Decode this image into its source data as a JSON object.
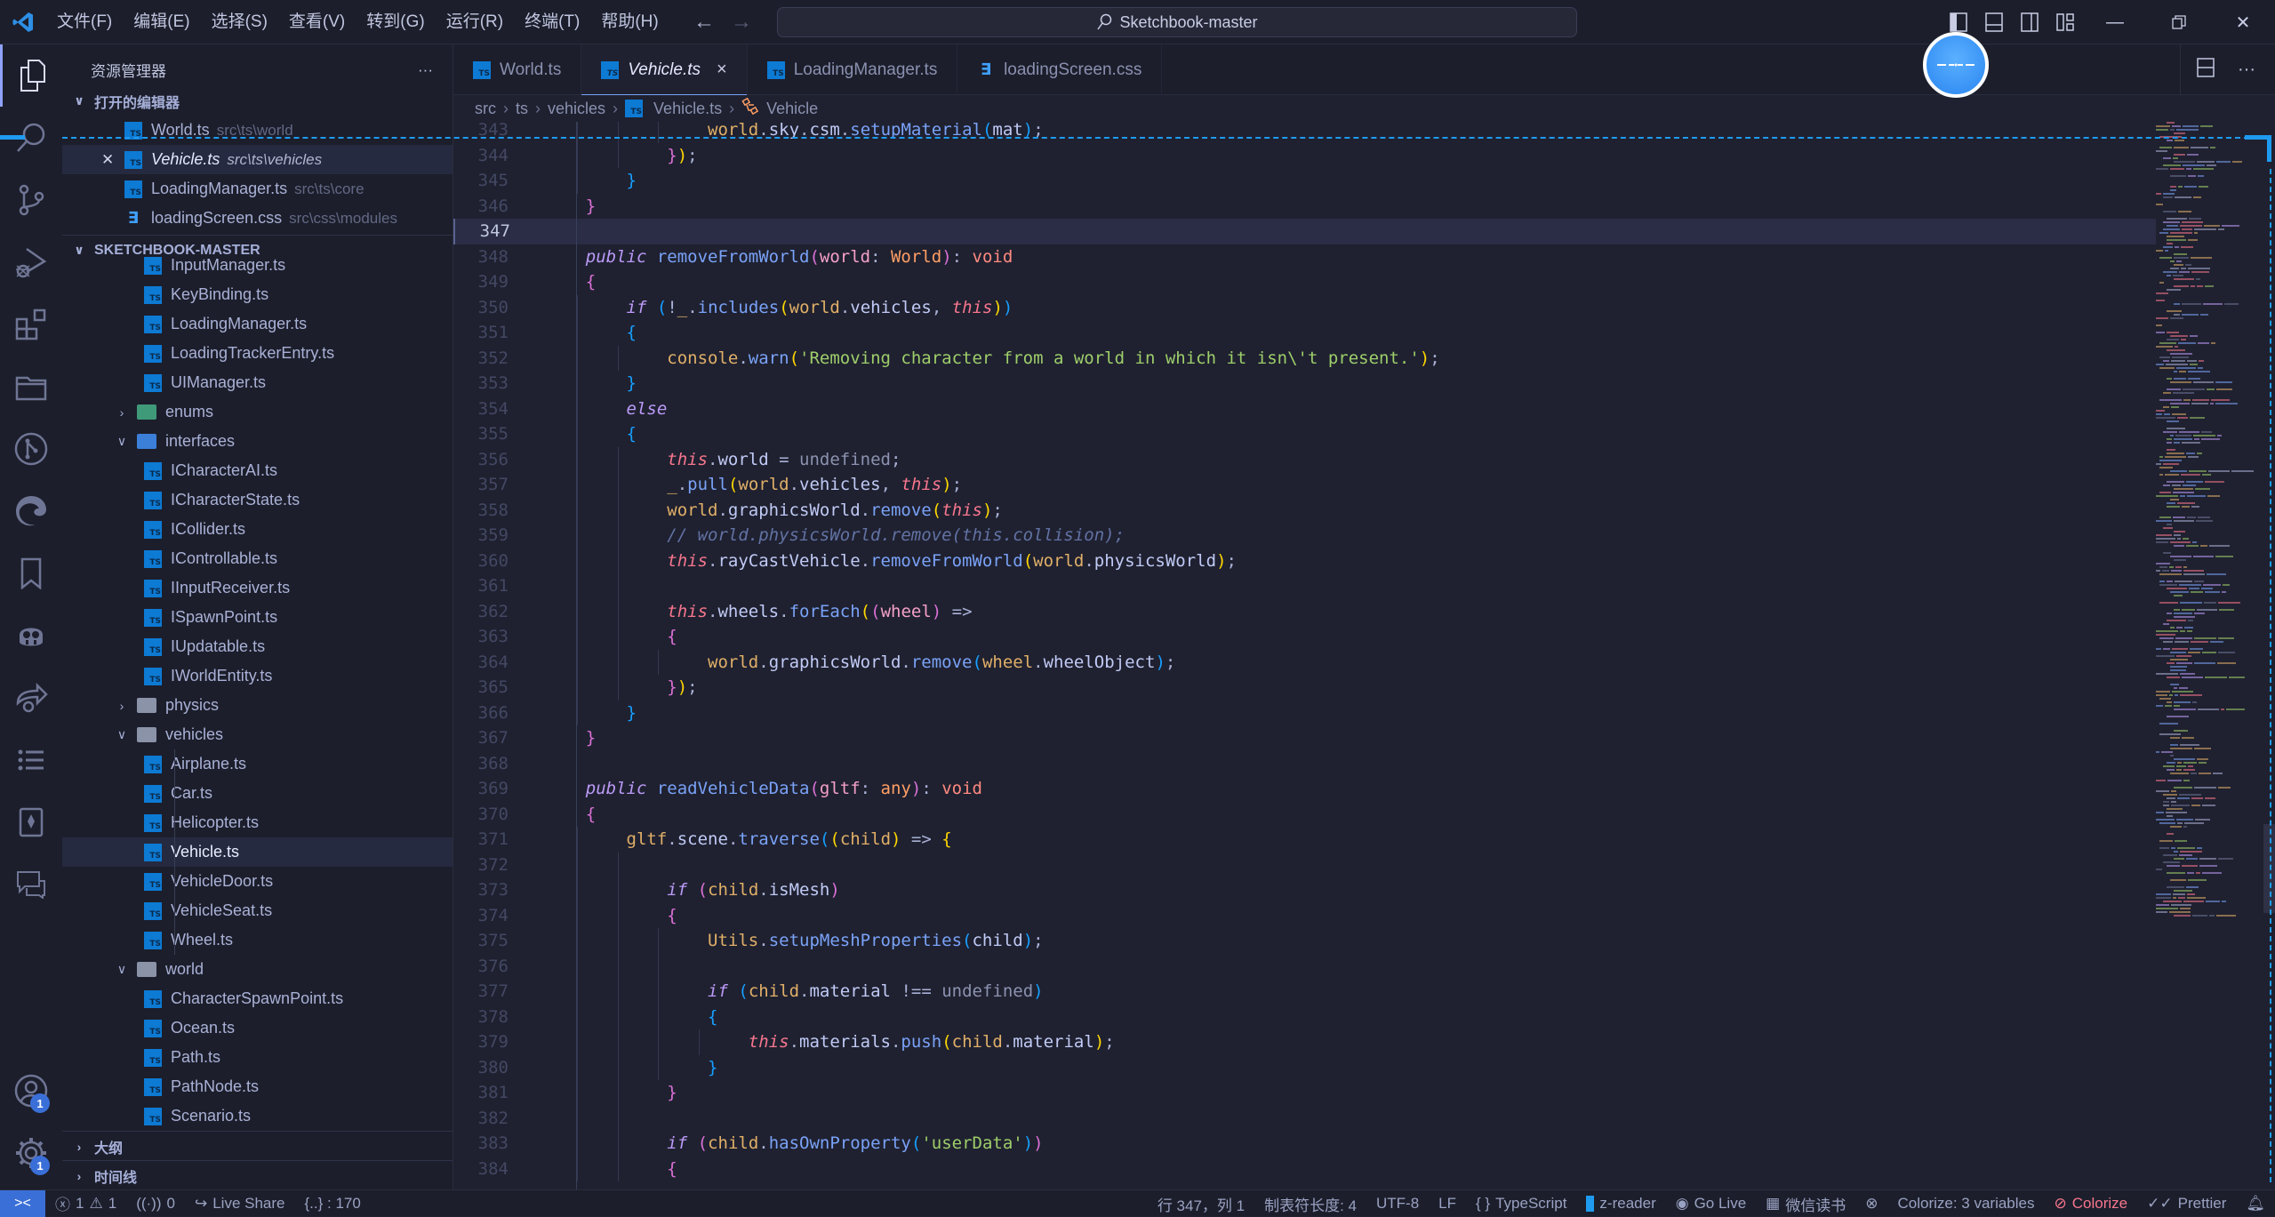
{
  "titlebar": {
    "menu": [
      "文件(F)",
      "编辑(E)",
      "选择(S)",
      "查看(V)",
      "转到(G)",
      "运行(R)",
      "终端(T)",
      "帮助(H)"
    ],
    "search_text": "Sketchbook-master"
  },
  "sidebar": {
    "title": "资源管理器",
    "more": "···",
    "open_editors": {
      "label": "打开的编辑器",
      "items": [
        {
          "name": "World.ts",
          "path": "src\\ts\\world",
          "icon": "ts"
        },
        {
          "name": "Vehicle.ts",
          "path": "src\\ts\\vehicles",
          "icon": "ts",
          "active": true
        },
        {
          "name": "LoadingManager.ts",
          "path": "src\\ts\\core",
          "icon": "ts"
        },
        {
          "name": "loadingScreen.css",
          "path": "src\\css\\modules",
          "icon": "css"
        }
      ]
    },
    "project": {
      "label": "SKETCHBOOK-MASTER",
      "tree": [
        {
          "name": "InputManager.ts",
          "type": "file",
          "depth": 2
        },
        {
          "name": "KeyBinding.ts",
          "type": "file",
          "depth": 2
        },
        {
          "name": "LoadingManager.ts",
          "type": "file",
          "depth": 2
        },
        {
          "name": "LoadingTrackerEntry.ts",
          "type": "file",
          "depth": 2
        },
        {
          "name": "UIManager.ts",
          "type": "file",
          "depth": 2
        },
        {
          "name": "enums",
          "type": "folder",
          "expanded": false,
          "depth": 1,
          "color": "green"
        },
        {
          "name": "interfaces",
          "type": "folder",
          "expanded": true,
          "depth": 1,
          "color": "blue"
        },
        {
          "name": "ICharacterAI.ts",
          "type": "file",
          "depth": 2
        },
        {
          "name": "ICharacterState.ts",
          "type": "file",
          "depth": 2
        },
        {
          "name": "ICollider.ts",
          "type": "file",
          "depth": 2
        },
        {
          "name": "IControllable.ts",
          "type": "file",
          "depth": 2
        },
        {
          "name": "IInputReceiver.ts",
          "type": "file",
          "depth": 2
        },
        {
          "name": "ISpawnPoint.ts",
          "type": "file",
          "depth": 2
        },
        {
          "name": "IUpdatable.ts",
          "type": "file",
          "depth": 2
        },
        {
          "name": "IWorldEntity.ts",
          "type": "file",
          "depth": 2
        },
        {
          "name": "physics",
          "type": "folder",
          "expanded": false,
          "depth": 1,
          "color": "grey"
        },
        {
          "name": "vehicles",
          "type": "folder",
          "expanded": true,
          "depth": 1,
          "color": "grey"
        },
        {
          "name": "Airplane.ts",
          "type": "file",
          "depth": 2
        },
        {
          "name": "Car.ts",
          "type": "file",
          "depth": 2
        },
        {
          "name": "Helicopter.ts",
          "type": "file",
          "depth": 2
        },
        {
          "name": "Vehicle.ts",
          "type": "file",
          "depth": 2,
          "selected": true
        },
        {
          "name": "VehicleDoor.ts",
          "type": "file",
          "depth": 2
        },
        {
          "name": "VehicleSeat.ts",
          "type": "file",
          "depth": 2
        },
        {
          "name": "Wheel.ts",
          "type": "file",
          "depth": 2
        },
        {
          "name": "world",
          "type": "folder",
          "expanded": true,
          "depth": 1,
          "color": "grey"
        },
        {
          "name": "CharacterSpawnPoint.ts",
          "type": "file",
          "depth": 2
        },
        {
          "name": "Ocean.ts",
          "type": "file",
          "depth": 2
        },
        {
          "name": "Path.ts",
          "type": "file",
          "depth": 2
        },
        {
          "name": "PathNode.ts",
          "type": "file",
          "depth": 2
        },
        {
          "name": "Scenario.ts",
          "type": "file",
          "depth": 2
        }
      ]
    },
    "outline_label": "大纲",
    "timeline_label": "时间线"
  },
  "activity_badges": {
    "accounts": "1",
    "settings": "1"
  },
  "tabs": [
    {
      "label": "World.ts",
      "icon": "ts"
    },
    {
      "label": "Vehicle.ts",
      "icon": "ts",
      "active": true
    },
    {
      "label": "LoadingManager.ts",
      "icon": "ts"
    },
    {
      "label": "loadingScreen.css",
      "icon": "css"
    }
  ],
  "tab_close": "×",
  "breadcrumb": [
    "src",
    "ts",
    "vehicles",
    "Vehicle.ts",
    "Vehicle"
  ],
  "editor": {
    "current_line": 347,
    "lines": [
      {
        "n": 343,
        "indent": 3,
        "html": "<span class=\"v\">world</span><span class=\"p\">.</span><span class=\"ob\">sky</span><span class=\"p\">.</span><span class=\"ob\">csm</span><span class=\"p\">.</span><span class=\"f\">setupMaterial</span><span class=\"b3\">(</span><span class=\"ob\">mat</span><span class=\"b3\">)</span><span class=\"p\">;</span>"
      },
      {
        "n": 344,
        "indent": 2,
        "html": "<span class=\"b2\">}</span><span class=\"b1\">)</span><span class=\"p\">;</span>"
      },
      {
        "n": 345,
        "indent": 1,
        "html": "<span class=\"b3\">}</span>"
      },
      {
        "n": 346,
        "indent": 0,
        "html": "<span class=\"b2\">}</span>"
      },
      {
        "n": 347,
        "indent": 0,
        "html": ""
      },
      {
        "n": 348,
        "indent": 0,
        "html": "<span class=\"k\">public</span> <span class=\"f\">removeFromWorld</span><span class=\"b2\">(</span><span class=\"param\">world</span><span class=\"p\">: </span><span class=\"ty\">World</span><span class=\"b2\">)</span><span class=\"p\">: </span><span class=\"vo\">void</span>"
      },
      {
        "n": 349,
        "indent": 0,
        "html": "<span class=\"b2\">{</span>"
      },
      {
        "n": 350,
        "indent": 1,
        "html": "<span class=\"k\">if</span> <span class=\"b3\">(</span><span class=\"p\">!</span><span class=\"v\">_</span><span class=\"p\">.</span><span class=\"f\">includes</span><span class=\"b1\">(</span><span class=\"v\">world</span><span class=\"p\">.</span><span class=\"ob\">vehicles</span><span class=\"p\">, </span><span class=\"t\">this</span><span class=\"b1\">)</span><span class=\"b3\">)</span>"
      },
      {
        "n": 351,
        "indent": 1,
        "html": "<span class=\"b3\">{</span>"
      },
      {
        "n": 352,
        "indent": 2,
        "html": "<span class=\"v\">console</span><span class=\"p\">.</span><span class=\"f\">warn</span><span class=\"b1\">(</span><span class=\"s\">'Removing character from a world in which it isn\\'t present.'</span><span class=\"b1\">)</span><span class=\"p\">;</span>"
      },
      {
        "n": 353,
        "indent": 1,
        "html": "<span class=\"b3\">}</span>"
      },
      {
        "n": 354,
        "indent": 1,
        "html": "<span class=\"k\">else</span>"
      },
      {
        "n": 355,
        "indent": 1,
        "html": "<span class=\"b3\">{</span>"
      },
      {
        "n": 356,
        "indent": 2,
        "html": "<span class=\"t\">this</span><span class=\"p\">.</span><span class=\"ob\">world</span><span class=\"p\"> = </span><span class=\"u\">undefined</span><span class=\"p\">;</span>"
      },
      {
        "n": 357,
        "indent": 2,
        "html": "<span class=\"v\">_</span><span class=\"p\">.</span><span class=\"f\">pull</span><span class=\"b1\">(</span><span class=\"v\">world</span><span class=\"p\">.</span><span class=\"ob\">vehicles</span><span class=\"p\">, </span><span class=\"t\">this</span><span class=\"b1\">)</span><span class=\"p\">;</span>"
      },
      {
        "n": 358,
        "indent": 2,
        "html": "<span class=\"v\">world</span><span class=\"p\">.</span><span class=\"ob\">graphicsWorld</span><span class=\"p\">.</span><span class=\"f\">remove</span><span class=\"b1\">(</span><span class=\"t\">this</span><span class=\"b1\">)</span><span class=\"p\">;</span>"
      },
      {
        "n": 359,
        "indent": 2,
        "html": "<span class=\"c\">// world.physicsWorld.remove(this.collision);</span>"
      },
      {
        "n": 360,
        "indent": 2,
        "html": "<span class=\"t\">this</span><span class=\"p\">.</span><span class=\"ob\">rayCastVehicle</span><span class=\"p\">.</span><span class=\"f\">removeFromWorld</span><span class=\"b1\">(</span><span class=\"v\">world</span><span class=\"p\">.</span><span class=\"ob\">physicsWorld</span><span class=\"b1\">)</span><span class=\"p\">;</span>"
      },
      {
        "n": 361,
        "indent": 2,
        "html": ""
      },
      {
        "n": 362,
        "indent": 2,
        "html": "<span class=\"t\">this</span><span class=\"p\">.</span><span class=\"ob\">wheels</span><span class=\"p\">.</span><span class=\"f\">forEach</span><span class=\"b1\">(</span><span class=\"b2\">(</span><span class=\"param\">wheel</span><span class=\"b2\">)</span><span class=\"p\"> =&gt;</span>"
      },
      {
        "n": 363,
        "indent": 2,
        "html": "<span class=\"b2\">{</span>"
      },
      {
        "n": 364,
        "indent": 3,
        "html": "<span class=\"v\">world</span><span class=\"p\">.</span><span class=\"ob\">graphicsWorld</span><span class=\"p\">.</span><span class=\"f\">remove</span><span class=\"b3\">(</span><span class=\"v\">wheel</span><span class=\"p\">.</span><span class=\"ob\">wheelObject</span><span class=\"b3\">)</span><span class=\"p\">;</span>"
      },
      {
        "n": 365,
        "indent": 2,
        "html": "<span class=\"b2\">}</span><span class=\"b1\">)</span><span class=\"p\">;</span>"
      },
      {
        "n": 366,
        "indent": 1,
        "html": "<span class=\"b3\">}</span>"
      },
      {
        "n": 367,
        "indent": 0,
        "html": "<span class=\"b2\">}</span>"
      },
      {
        "n": 368,
        "indent": 0,
        "html": ""
      },
      {
        "n": 369,
        "indent": 0,
        "html": "<span class=\"k\">public</span> <span class=\"f\">readVehicleData</span><span class=\"b2\">(</span><span class=\"param\">gltf</span><span class=\"p\">: </span><span class=\"ty\">any</span><span class=\"b2\">)</span><span class=\"p\">: </span><span class=\"vo\">void</span>"
      },
      {
        "n": 370,
        "indent": 0,
        "html": "<span class=\"b2\">{</span>"
      },
      {
        "n": 371,
        "indent": 1,
        "html": "<span class=\"v\">gltf</span><span class=\"p\">.</span><span class=\"ob\">scene</span><span class=\"p\">.</span><span class=\"f\">traverse</span><span class=\"b3\">(</span><span class=\"b1\">(</span><span class=\"v\">child</span><span class=\"b1\">)</span><span class=\"p\"> =&gt; </span><span class=\"b1\">{</span>"
      },
      {
        "n": 372,
        "indent": 2,
        "html": ""
      },
      {
        "n": 373,
        "indent": 2,
        "html": "<span class=\"k\">if</span> <span class=\"b2\">(</span><span class=\"v\">child</span><span class=\"p\">.</span><span class=\"ob\">isMesh</span><span class=\"b2\">)</span>"
      },
      {
        "n": 374,
        "indent": 2,
        "html": "<span class=\"b2\">{</span>"
      },
      {
        "n": 375,
        "indent": 3,
        "html": "<span class=\"v\">Utils</span><span class=\"p\">.</span><span class=\"f\">setupMeshProperties</span><span class=\"b3\">(</span><span class=\"ob\">child</span><span class=\"b3\">)</span><span class=\"p\">;</span>"
      },
      {
        "n": 376,
        "indent": 3,
        "html": ""
      },
      {
        "n": 377,
        "indent": 3,
        "html": "<span class=\"k\">if</span> <span class=\"b3\">(</span><span class=\"v\">child</span><span class=\"p\">.</span><span class=\"ob\">material</span><span class=\"p\"> !== </span><span class=\"u\">undefined</span><span class=\"b3\">)</span>"
      },
      {
        "n": 378,
        "indent": 3,
        "html": "<span class=\"b3\">{</span>"
      },
      {
        "n": 379,
        "indent": 4,
        "html": "<span class=\"t\">this</span><span class=\"p\">.</span><span class=\"ob\">materials</span><span class=\"p\">.</span><span class=\"f\">push</span><span class=\"b1\">(</span><span class=\"v\">child</span><span class=\"p\">.</span><span class=\"ob\">material</span><span class=\"b1\">)</span><span class=\"p\">;</span>"
      },
      {
        "n": 380,
        "indent": 3,
        "html": "<span class=\"b3\">}</span>"
      },
      {
        "n": 381,
        "indent": 2,
        "html": "<span class=\"b2\">}</span>"
      },
      {
        "n": 382,
        "indent": 2,
        "html": ""
      },
      {
        "n": 383,
        "indent": 2,
        "html": "<span class=\"k\">if</span> <span class=\"b2\">(</span><span class=\"v\">child</span><span class=\"p\">.</span><span class=\"f\">hasOwnProperty</span><span class=\"b3\">(</span><span class=\"s\">'userData'</span><span class=\"b3\">)</span><span class=\"b2\">)</span>"
      },
      {
        "n": 384,
        "indent": 2,
        "html": "<span class=\"b2\">{</span>"
      }
    ]
  },
  "statusbar": {
    "errors": "1",
    "warnings": "1",
    "ports": "0",
    "live_share": "Live Share",
    "bracket_info": "{..} : 170",
    "position": "行 347，列 1",
    "tab_size": "制表符长度: 4",
    "encoding": "UTF-8",
    "eol": "LF",
    "language": "TypeScript",
    "zreader": "z-reader",
    "go_live": "Go Live",
    "weixin": "微信读书",
    "colorize_vars": "Colorize: 3 variables",
    "colorize": "Colorize",
    "prettier": "Prettier"
  },
  "colors": {
    "accent": "#7aa2f7",
    "overlay_blue": "#1e9bf0",
    "error_red": "#f7768e"
  }
}
